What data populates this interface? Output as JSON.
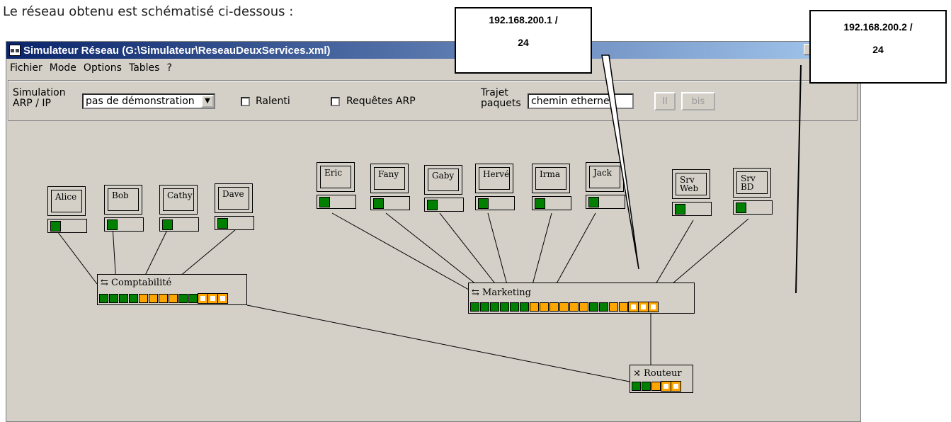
{
  "caption": "Le réseau obtenu est schématisé ci-dessous :",
  "window": {
    "title": "Simulateur Réseau (G:\\Simulateur\\ReseauDeuxServices.xml)"
  },
  "menu": [
    "Fichier",
    "Mode",
    "Options",
    "Tables",
    "?"
  ],
  "toolbar": {
    "sim_label_1": "Simulation",
    "sim_label_2": "ARP / IP",
    "sim_value": "pas de démonstration",
    "ralenti": "Ralenti",
    "requetes": "Requêtes ARP",
    "trajet_1": "Trajet",
    "trajet_2": "paquets",
    "trajet_value": "chemin ethernet",
    "pause": "II",
    "bis": "bis"
  },
  "hosts": [
    {
      "label": "Alice"
    },
    {
      "label": "Bob"
    },
    {
      "label": "Cathy"
    },
    {
      "label": "Dave"
    },
    {
      "label": "Eric"
    },
    {
      "label": "Fany"
    },
    {
      "label": "Gaby"
    },
    {
      "label": "Hervé"
    },
    {
      "label": "Irma"
    },
    {
      "label": "Jack"
    },
    {
      "label": "Srv\nWeb"
    },
    {
      "label": "Srv\nBD"
    }
  ],
  "switches": {
    "comptabilite": {
      "label": "Comptabilité",
      "ports": [
        "g",
        "g",
        "g",
        "g",
        "o",
        "o",
        "o",
        "o",
        "g",
        "g",
        "oh",
        "oh",
        "oh"
      ]
    },
    "marketing": {
      "label": "Marketing",
      "ports": [
        "g",
        "g",
        "g",
        "g",
        "g",
        "g",
        "o",
        "o",
        "o",
        "o",
        "o",
        "o",
        "g",
        "g",
        "o",
        "o",
        "oh",
        "oh",
        "oh"
      ]
    },
    "routeur": {
      "label": "Routeur",
      "ports": [
        "g",
        "g",
        "o",
        "oh",
        "oh"
      ]
    }
  },
  "callouts": {
    "left_line1": "192.168.200.1 /",
    "left_line2": "24",
    "right_line1": "192.168.200.2 /",
    "right_line2": "24"
  },
  "colors": {
    "port_green": "#008000",
    "port_orange": "#ffa500",
    "titlebar": "#0a246a"
  }
}
